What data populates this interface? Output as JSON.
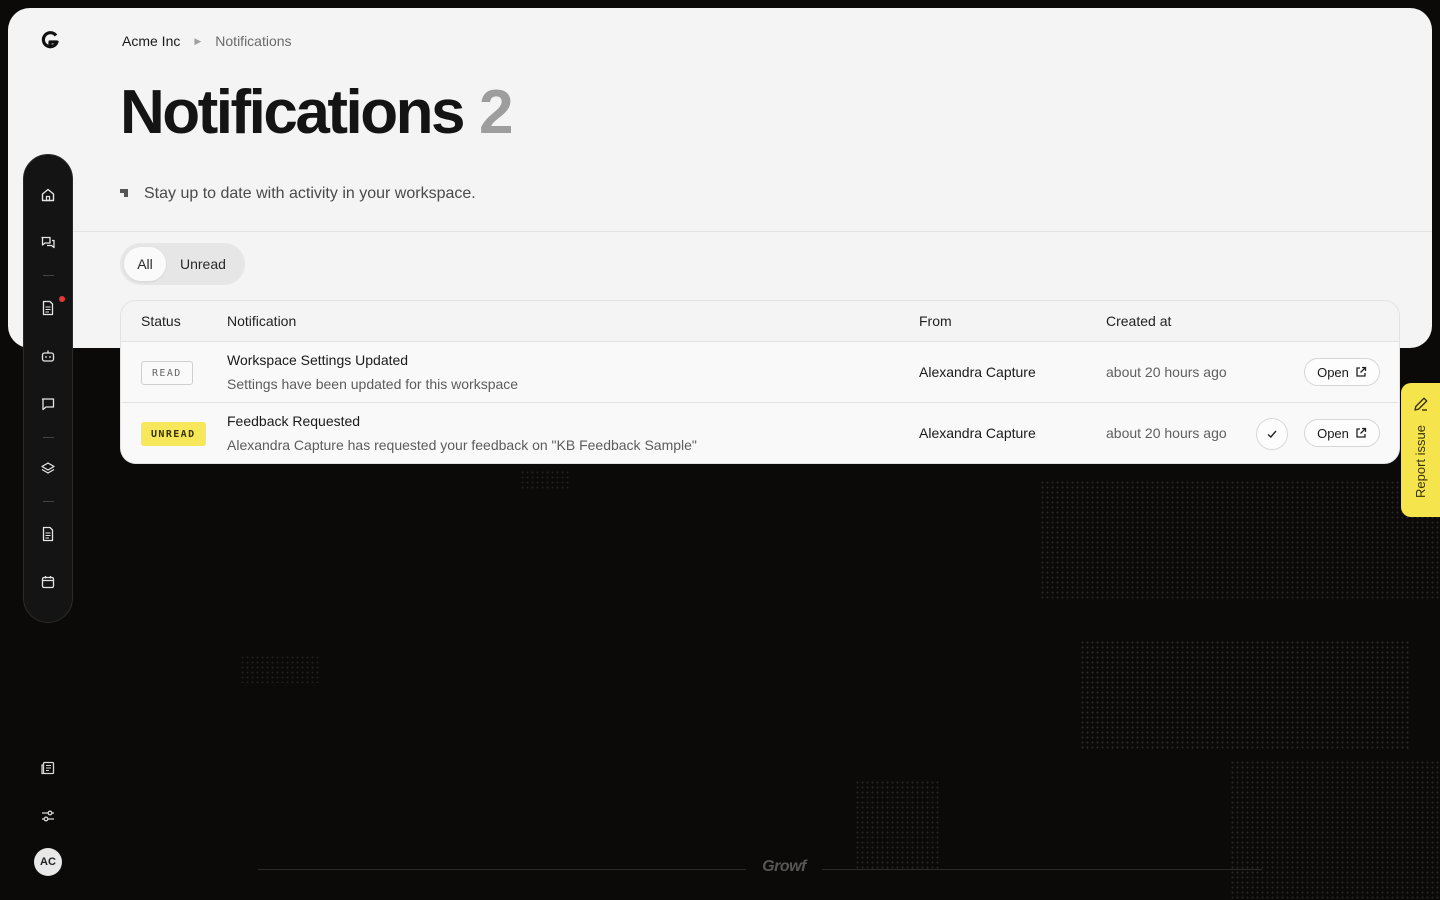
{
  "breadcrumb": {
    "org": "Acme Inc",
    "current": "Notifications"
  },
  "page": {
    "title": "Notifications",
    "count": "2",
    "subtitle": "Stay up to date with activity in your workspace."
  },
  "filters": {
    "all": "All",
    "unread": "Unread",
    "selected": "All"
  },
  "table": {
    "columns": {
      "status": "Status",
      "notification": "Notification",
      "from": "From",
      "created": "Created at"
    },
    "rows": [
      {
        "status": "READ",
        "title": "Workspace Settings Updated",
        "description": "Settings have been updated for this workspace",
        "from": "Alexandra Capture",
        "created": "about 20 hours ago",
        "action": "Open"
      },
      {
        "status": "UNREAD",
        "title": "Feedback Requested",
        "description": "Alexandra Capture has requested your feedback on \"KB Feedback Sample\"",
        "from": "Alexandra Capture",
        "created": "about 20 hours ago",
        "action": "Open"
      }
    ]
  },
  "sidebar": {
    "icons": [
      "home-icon",
      "chat-icon",
      "document-icon",
      "bot-icon",
      "message-icon",
      "layers-icon",
      "file-icon",
      "calendar-icon"
    ],
    "bottom_icons": [
      "news-icon",
      "settings-sliders-icon"
    ]
  },
  "user": {
    "initials": "AC"
  },
  "report_issue": "Report issue",
  "footer": {
    "brand": "Growf"
  },
  "colors": {
    "accent": "#f6e85a",
    "panel": "#f4f4f4",
    "background": "#0b0a09",
    "notification_dot": "#e53935"
  }
}
